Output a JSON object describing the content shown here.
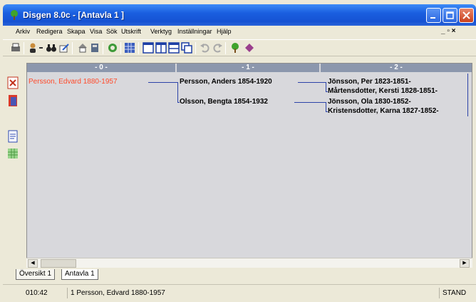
{
  "window": {
    "title": "Disgen 8.0c - [Antavla 1 ]"
  },
  "colors": {
    "titlebar": "#1552d3",
    "chart_bg": "#d8d8dc",
    "header_bg": "#8c97ad",
    "root_person": "#ff4a2a",
    "lines": "#2c43a8"
  },
  "menu": {
    "items": [
      "Arkiv",
      "Redigera",
      "Skapa",
      "Visa",
      "Sök",
      "Utskrift",
      "Verktyg",
      "Inställningar",
      "Hjälp"
    ],
    "mdi_controls": "_ ▫ ×"
  },
  "toolbar": {
    "icons": [
      "print-icon",
      "person-icon",
      "dropdown-arrow-icon",
      "binoculars-icon",
      "edit-icon",
      "home-icon",
      "book-icon",
      "recycle-icon",
      "grid-icon",
      "window-single-icon",
      "window-split-v-icon",
      "window-split-h-icon",
      "window-cascade-icon",
      "undo-icon",
      "redo-icon",
      "tree-icon",
      "gem-icon"
    ]
  },
  "left_tools": {
    "icons": [
      "close-chart-icon",
      "document-red-icon",
      "document-new-icon",
      "grid-green-icon"
    ]
  },
  "chart": {
    "generations": [
      "- 0 -",
      "- 1 -",
      "- 2 -"
    ],
    "root": "Persson, Edvard 1880-1957",
    "gen1": [
      "Persson, Anders 1854-1920",
      "Olsson, Bengta 1854-1932"
    ],
    "gen2": [
      "Jönsson, Per 1823-1851-",
      "Mårtensdotter, Kersti 1828-1851-",
      "Jönsson, Ola 1830-1852-",
      "Kristensdotter, Karna 1827-1852-"
    ]
  },
  "tabs": [
    "Översikt 1",
    "Antavla 1"
  ],
  "status": {
    "time": "010:42",
    "selection": "1 Persson, Edvard 1880-1957",
    "mode": "STAND"
  }
}
